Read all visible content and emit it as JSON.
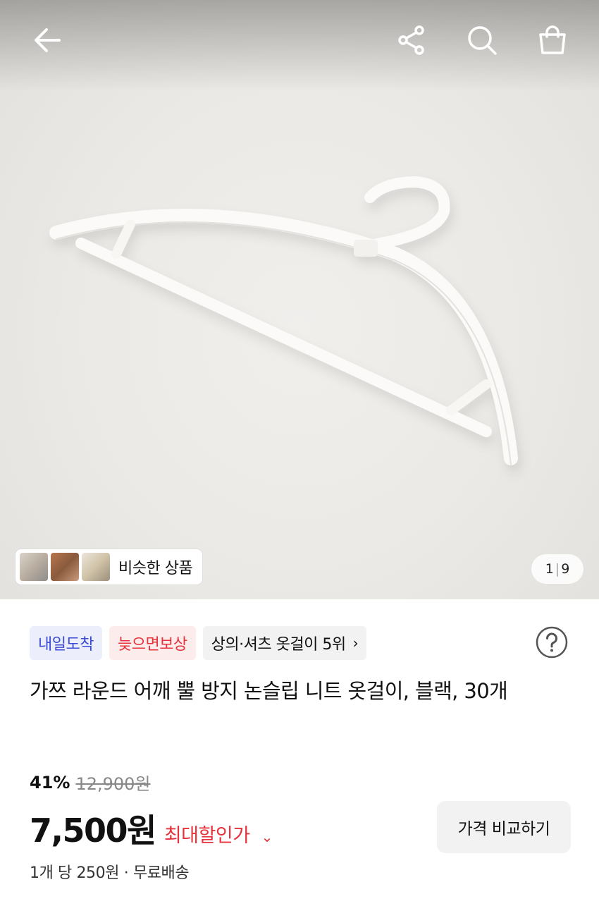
{
  "header": {
    "back_icon": "arrow-left-icon",
    "share_icon": "share-icon",
    "search_icon": "search-icon",
    "cart_icon": "shopping-bag-icon"
  },
  "gallery": {
    "similar_label": "비슷한 상품",
    "counter_current": "1",
    "counter_total": "9"
  },
  "badges": {
    "tomorrow": "내일도착",
    "late_comp": "늦으면보상",
    "ranking": "상의·셔츠 옷걸이 5위"
  },
  "product": {
    "title": "가쯔 라운드 어깨 뿔 방지 논슬립 니트 옷걸이, 블랙, 30개",
    "discount_rate": "41%",
    "original_price": "12,900원",
    "price": "7,500원",
    "max_discount_label": "최대할인가",
    "compare_button": "가격 비교하기",
    "unit_info": "1개 당 250원 · 무료배송"
  },
  "colors": {
    "accent_blue": "#3b4bd6",
    "accent_red": "#e5323b"
  }
}
